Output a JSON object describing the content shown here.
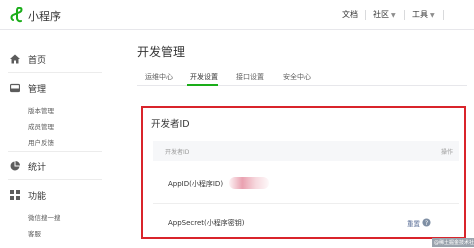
{
  "header": {
    "brand": "小程序",
    "nav": [
      {
        "label": "文档",
        "has_menu": false
      },
      {
        "label": "社区",
        "has_menu": true
      },
      {
        "label": "工具",
        "has_menu": true
      }
    ]
  },
  "sidebar": {
    "items": [
      {
        "label": "首页",
        "icon": "home-icon"
      },
      {
        "label": "管理",
        "icon": "manage-icon",
        "children": [
          "版本管理",
          "成员管理",
          "用户反馈"
        ]
      },
      {
        "label": "统计",
        "icon": "stats-icon"
      },
      {
        "label": "功能",
        "icon": "features-icon",
        "children": [
          "微信搜一搜",
          "客服"
        ]
      }
    ]
  },
  "main": {
    "title": "开发管理",
    "tabs": [
      "运维中心",
      "开发设置",
      "接口设置",
      "安全中心"
    ],
    "active_tab": "开发设置",
    "panel": {
      "title": "开发者ID",
      "columns": {
        "left": "开发者ID",
        "right": "操作"
      },
      "rows": [
        {
          "label": "AppID(小程序ID)",
          "value_redacted": true
        },
        {
          "label": "AppSecret(小程序密钥)",
          "action": "重置"
        }
      ]
    }
  },
  "watermark": "@稀土掘金技术社区",
  "colors": {
    "accent_green": "#1aad19",
    "highlight_red": "#d9242b",
    "link": "#576b95"
  }
}
